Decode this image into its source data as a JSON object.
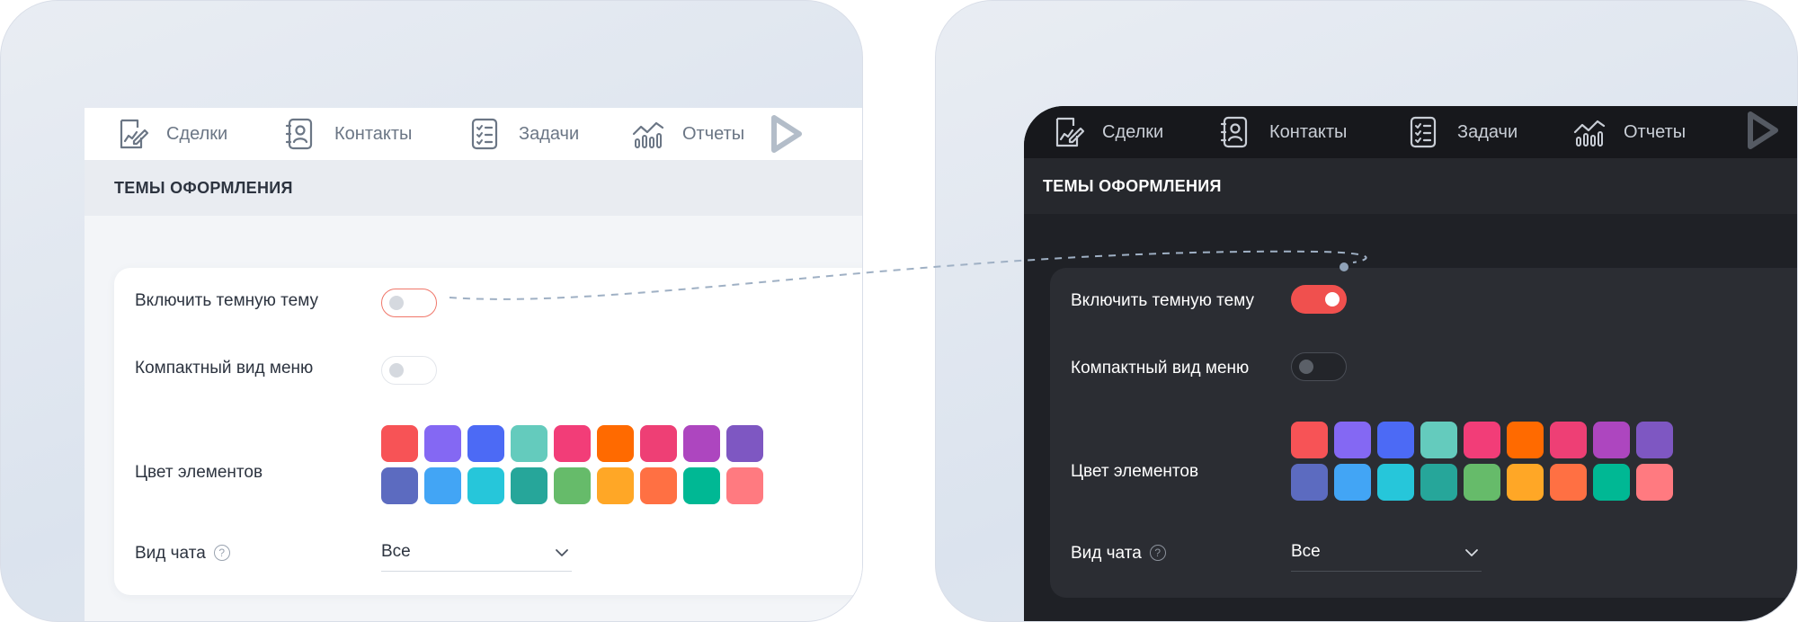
{
  "colors": {
    "accent": "#f0504e",
    "light_text": "#2d3440",
    "dark_text": "#ffffff",
    "light_toggle_border_active": "#f0776a",
    "dark_toggle_on": "#f0504e"
  },
  "nav": {
    "items": [
      {
        "label": "Сделки",
        "icon": "deal-edit-icon"
      },
      {
        "label": "Контакты",
        "icon": "contact-book-icon"
      },
      {
        "label": "Задачи",
        "icon": "task-list-icon"
      },
      {
        "label": "Отчеты",
        "icon": "report-chart-icon"
      }
    ],
    "logo_icon": "play-logo-icon"
  },
  "section": {
    "title": "ТЕМЫ ОФОРМЛЕНИЯ"
  },
  "settings": {
    "dark_theme_label": "Включить темную тему",
    "compact_menu_label": "Компактный вид меню",
    "colors_label": "Цвет элементов",
    "chat_view_label": "Вид чата",
    "help_glyph": "?",
    "chat_view_value": "Все"
  },
  "light_panel": {
    "dark_theme_on": false,
    "compact_menu_on": false
  },
  "dark_panel": {
    "dark_theme_on": true,
    "compact_menu_on": false
  },
  "palette": [
    "#f75356",
    "#8468f3",
    "#4c6af5",
    "#64cbbd",
    "#f23d78",
    "#ff6a00",
    "#ee3f75",
    "#ad46bf",
    "#7e57c2",
    "#5c6bc0",
    "#42a5f5",
    "#26c6da",
    "#26a69a",
    "#66bb6a",
    "#ffa726",
    "#ff7043",
    "#00b894",
    "#ff7a80"
  ]
}
